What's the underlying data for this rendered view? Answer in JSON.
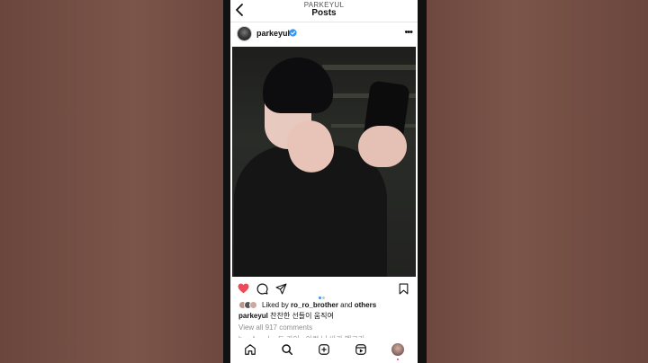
{
  "header": {
    "account_name": "PARKEYUL",
    "title": "Posts"
  },
  "post": {
    "username": "parkeyul",
    "verified": true,
    "liked_by_prefix": "Liked by ",
    "liked_by_user": "ro_ro_brother",
    "liked_by_suffix": " and ",
    "liked_by_others": "others",
    "caption_user": "parkeyul",
    "caption_text": " 찬찬한 선들이 움직여",
    "view_comments": "View all 917 comments",
    "partial_comment": "h... 소 ... 노..드 가이.. 이런 님 바라 벨크기"
  },
  "colors": {
    "like_red": "#ed4956",
    "accent_blue": "#3897f0"
  },
  "icons": {
    "back": "chevron-left-icon",
    "more": "more-horizontal-icon",
    "like": "heart-icon",
    "comment": "comment-icon",
    "share": "send-icon",
    "save": "bookmark-icon",
    "home": "home-icon",
    "search": "search-icon",
    "create": "plus-square-icon",
    "reels": "reels-icon",
    "profile": "profile-avatar"
  }
}
